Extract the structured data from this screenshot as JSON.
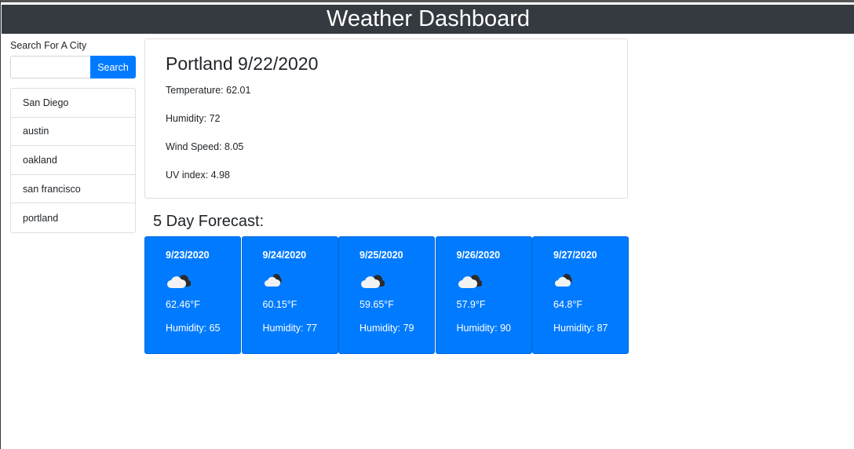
{
  "header": {
    "title": "Weather Dashboard"
  },
  "search": {
    "label": "Search For A City",
    "value": "",
    "placeholder": "",
    "button_label": "Search"
  },
  "cities": [
    "San Diego",
    "austin",
    "oakland",
    "san francisco",
    "portland"
  ],
  "current": {
    "title": "Portland 9/22/2020",
    "temperature": "Temperature: 62.01",
    "humidity": "Humidity: 72",
    "wind": "Wind Speed: 8.05",
    "uv": "UV index: 4.98"
  },
  "forecast": {
    "heading": "5 Day Forecast:",
    "days": [
      {
        "date": "9/23/2020",
        "icon": "cloud-icon",
        "temp": "62.46°F",
        "humidity": "Humidity: 65"
      },
      {
        "date": "9/24/2020",
        "icon": "cloud-icon",
        "temp": "60.15°F",
        "humidity": "Humidity: 77"
      },
      {
        "date": "9/25/2020",
        "icon": "cloud-icon",
        "temp": "59.65°F",
        "humidity": "Humidity: 79"
      },
      {
        "date": "9/26/2020",
        "icon": "cloud-icon",
        "temp": "57.9°F",
        "humidity": "Humidity: 90"
      },
      {
        "date": "9/27/2020",
        "icon": "cloud-icon",
        "temp": "64.8°F",
        "humidity": "Humidity: 87"
      }
    ]
  },
  "colors": {
    "header_bg": "#343a40",
    "accent": "#007bff"
  }
}
